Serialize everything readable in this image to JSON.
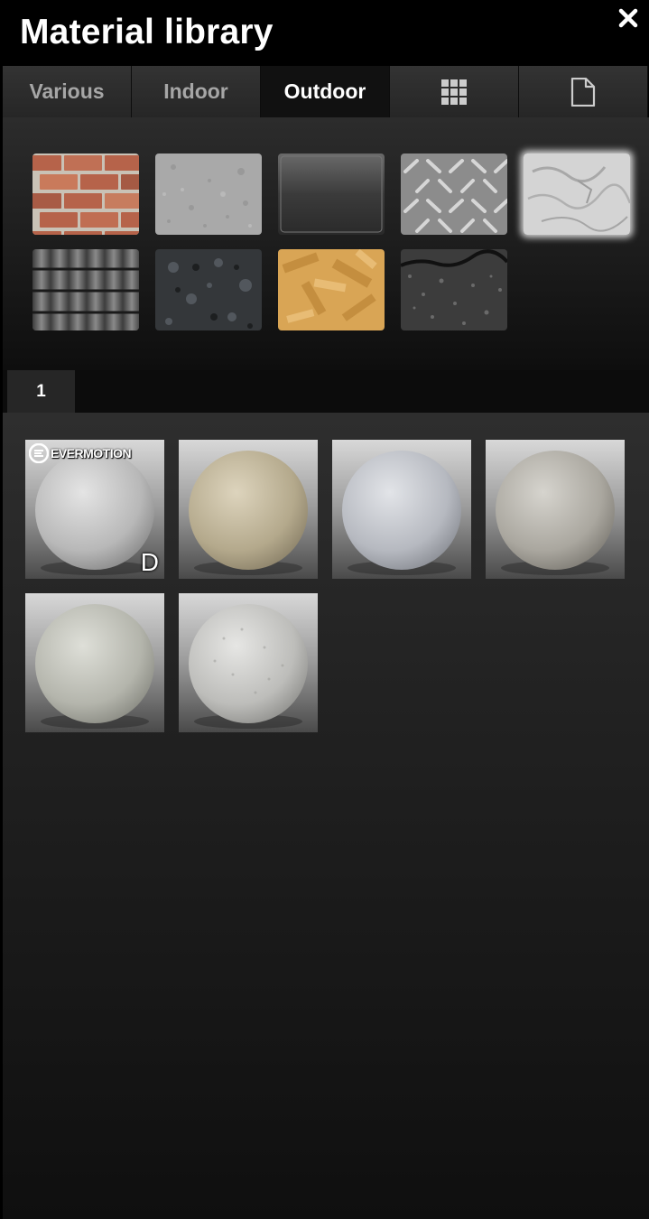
{
  "header": {
    "title": "Material library",
    "close_icon": "close-icon"
  },
  "tabs": [
    {
      "label": "Various",
      "active": false
    },
    {
      "label": "Indoor",
      "active": false
    },
    {
      "label": "Outdoor",
      "active": true
    },
    {
      "icon": "grid-icon"
    },
    {
      "icon": "document-icon"
    }
  ],
  "categories": [
    {
      "name": "brick"
    },
    {
      "name": "concrete"
    },
    {
      "name": "glass"
    },
    {
      "name": "tread-plate"
    },
    {
      "name": "plaster",
      "selected": true
    },
    {
      "name": "roof-tiles"
    },
    {
      "name": "granite"
    },
    {
      "name": "osb-wood"
    },
    {
      "name": "asphalt"
    }
  ],
  "pages": [
    {
      "label": "1",
      "active": true
    }
  ],
  "materials": [
    {
      "name": "plaster-1",
      "brand": "EVERMOTION",
      "badge": "D"
    },
    {
      "name": "plaster-2"
    },
    {
      "name": "plaster-3"
    },
    {
      "name": "plaster-4"
    },
    {
      "name": "plaster-5"
    },
    {
      "name": "plaster-6"
    }
  ],
  "colors": {
    "background": "#000000",
    "tab_inactive_text": "#a6a6a6",
    "tab_active_text": "#ffffff",
    "brick": "#b8694e",
    "osb": "#d9a555"
  }
}
